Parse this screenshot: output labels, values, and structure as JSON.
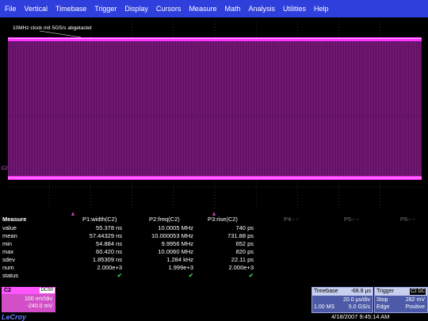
{
  "menu": [
    "File",
    "Vertical",
    "Timebase",
    "Trigger",
    "Display",
    "Cursors",
    "Measure",
    "Math",
    "Analysis",
    "Utilities",
    "Help"
  ],
  "trace_title": "10MHz clock mit 5GS/s abgetastet",
  "channel_marker": "C2",
  "trace_color": "#ff33ff",
  "measure": {
    "header": {
      "label": "Measure",
      "p1": "P1:width(C2)",
      "p2": "P2:freq(C2)",
      "p3": "P3:rise(C2)",
      "p4": "P4:- -",
      "p5": "P5:- -",
      "p6": "P6:- -"
    },
    "rows": [
      {
        "label": "value",
        "p1": "55.378 ns",
        "p2": "10.0005 MHz",
        "p3": "740 ps"
      },
      {
        "label": "mean",
        "p1": "57.44329 ns",
        "p2": "10.000053 MHz",
        "p3": "731.88 ps"
      },
      {
        "label": "min",
        "p1": "54.884 ns",
        "p2": "9.9956 MHz",
        "p3": "652 ps"
      },
      {
        "label": "max",
        "p1": "60.420 ns",
        "p2": "10.0060 MHz",
        "p3": "820 ps"
      },
      {
        "label": "sdev",
        "p1": "1.85309 ns",
        "p2": "1.284 kHz",
        "p3": "22.11 ps"
      },
      {
        "label": "num",
        "p1": "2.000e+3",
        "p2": "1.999e+3",
        "p3": "2.000e+3"
      },
      {
        "label": "status",
        "p1": "✔",
        "p2": "✔",
        "p3": "✔"
      }
    ]
  },
  "channel_box": {
    "name": "C2",
    "coupling": "DC50",
    "vdiv": "100 mV/div",
    "offset": "-240.0 mV"
  },
  "brand": "LeCroy",
  "timebase": {
    "label": "Timebase",
    "delay": "-68.8 µs",
    "tdiv": "20.0 µs/div",
    "samples": "1.00 MS",
    "rate": "5.0 GS/s"
  },
  "trigger": {
    "label": "Trigger",
    "source": "C2 DC",
    "mode": "Stop",
    "level": "282 mV",
    "type": "Edge",
    "slope": "Positive"
  },
  "datetime": "4/18/2007 9:45:14 AM"
}
